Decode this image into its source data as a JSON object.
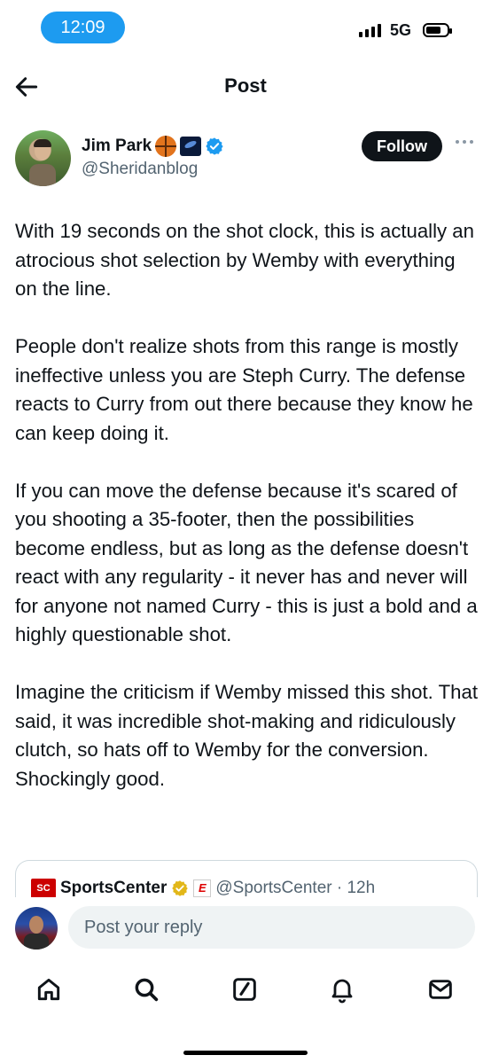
{
  "status_bar": {
    "time": "12:09",
    "network": "5G"
  },
  "header": {
    "title": "Post",
    "back_icon": "arrow-left-icon"
  },
  "author": {
    "name": "Jim Park",
    "handle": "@Sheridanblog",
    "badges": [
      "basketball-emoji",
      "galaxy-emoji",
      "verified-icon"
    ],
    "follow_label": "Follow",
    "more_icon": "more-dots-icon"
  },
  "post": {
    "paragraphs": [
      "With 19 seconds on the shot clock, this is actually an atrocious shot selection by Wemby with everything on the line.",
      "People don't realize shots from this range is mostly ineffective unless you are Steph Curry. The defense reacts to Curry from out there because they know he can keep doing it.",
      "If you can move the defense because it's scared of you shooting a 35-footer, then the possibilities become endless, but as long as the defense doesn't react with any regularity - it never has and never will for anyone not named Curry - this is just a bold and a highly questionable shot.",
      "Imagine the criticism if Wemby missed this shot. That said, it was incredible shot-making and ridiculously clutch, so hats off to Wemby for the conversion. Shockingly good."
    ]
  },
  "quote": {
    "logo_text": "SC",
    "name": "SportsCenter",
    "espn_badge": "E",
    "handle_time": "@SportsCenter · 12h"
  },
  "reply": {
    "placeholder": "Post your reply"
  },
  "nav": {
    "items": [
      "home-icon",
      "search-icon",
      "compose-icon",
      "notifications-icon",
      "messages-icon"
    ]
  },
  "colors": {
    "accent": "#1d9bf0",
    "text": "#0f1419",
    "secondary": "#536471",
    "follow_bg": "#0f1419"
  }
}
